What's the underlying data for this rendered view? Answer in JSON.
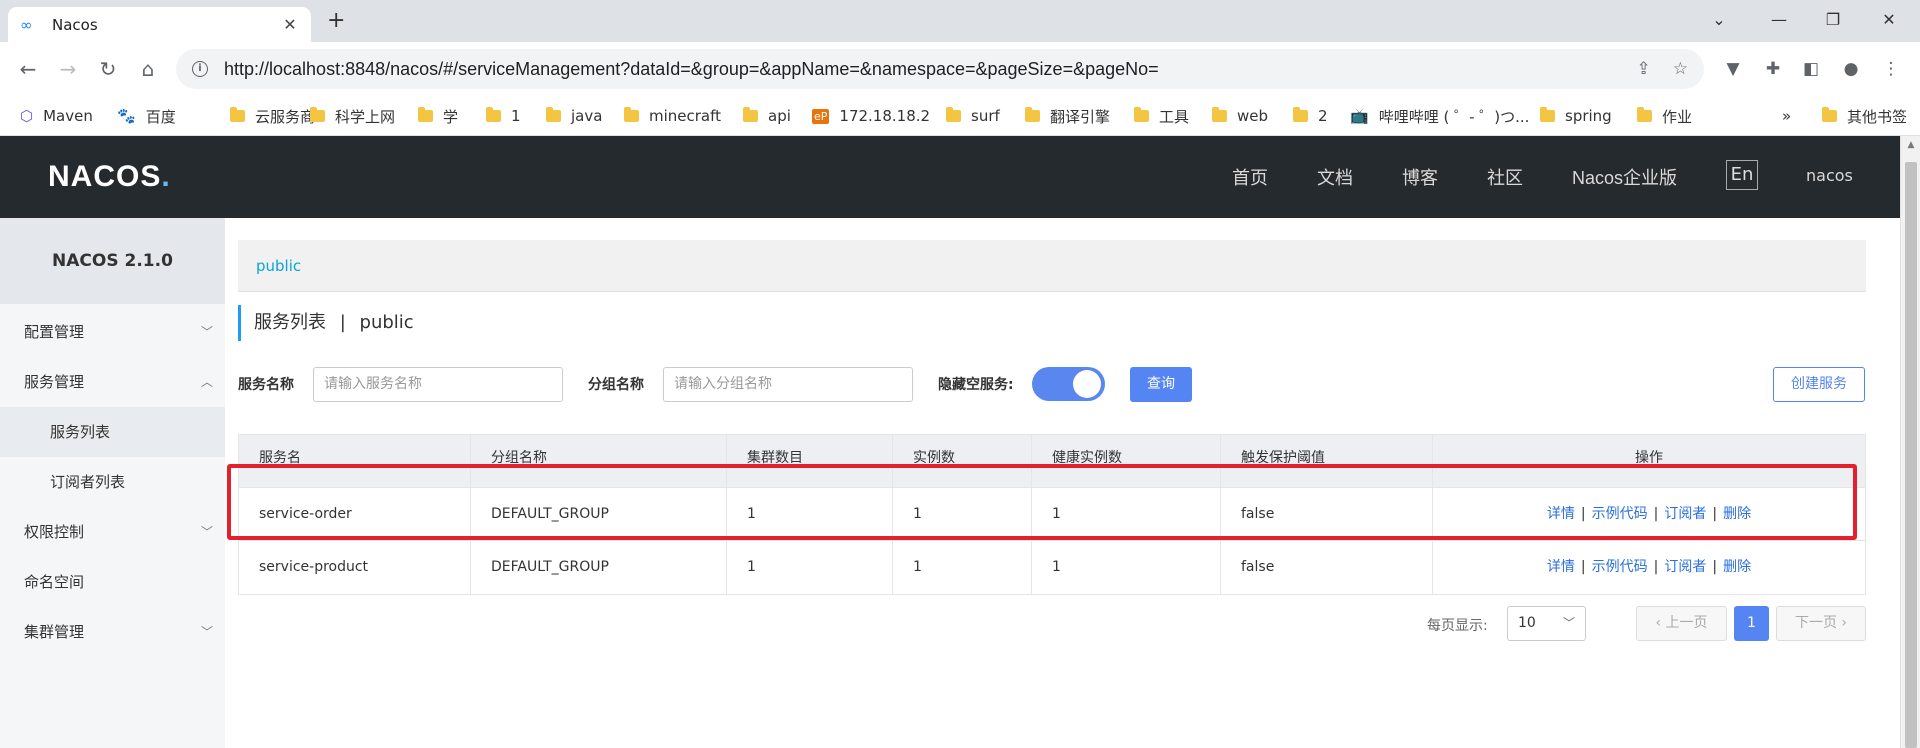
{
  "browser": {
    "tab_title": "Nacos",
    "url": "http://localhost:8848/nacos/#/serviceManagement?dataId=&group=&appName=&namespace=&pageSize=&pageNo=",
    "bookmarks": [
      "Maven",
      "百度",
      "云服务商",
      "科学上网",
      "学",
      "1",
      "java",
      "minecraft",
      "api",
      "172.18.18.2",
      "surf",
      "翻译引擎",
      "工具",
      "web",
      "2",
      "哔哩哔哩 ( ゜- ゜)つ...",
      "spring",
      "作业"
    ],
    "bookmarks_more": "»",
    "other_bookmarks": "其他书签"
  },
  "header": {
    "logo": "NACOS",
    "logo_dot": ".",
    "nav": [
      "首页",
      "文档",
      "博客",
      "社区",
      "Nacos企业版"
    ],
    "lang": "En",
    "user": "nacos"
  },
  "sidebar": {
    "title": "NACOS 2.1.0",
    "items": [
      {
        "label": "配置管理"
      },
      {
        "label": "服务管理"
      },
      {
        "label": "服务列表"
      },
      {
        "label": "订阅者列表"
      },
      {
        "label": "权限控制"
      },
      {
        "label": "命名空间"
      },
      {
        "label": "集群管理"
      }
    ]
  },
  "main": {
    "namespace_tab": "public",
    "page_title": "服务列表",
    "title_sep": "|",
    "title_ns": "public",
    "filters": {
      "service_name_label": "服务名称",
      "service_name_placeholder": "请输入服务名称",
      "group_name_label": "分组名称",
      "group_name_placeholder": "请输入分组名称",
      "hide_empty_label": "隐藏空服务:",
      "hide_empty_on": true,
      "query_button": "查询",
      "create_button": "创建服务"
    },
    "table": {
      "headers": [
        "服务名",
        "分组名称",
        "集群数目",
        "实例数",
        "健康实例数",
        "触发保护阈值",
        "操作"
      ],
      "rows": [
        {
          "name": "service-order",
          "group": "DEFAULT_GROUP",
          "clusters": "1",
          "instances": "1",
          "healthy": "1",
          "threshold": "false"
        },
        {
          "name": "service-product",
          "group": "DEFAULT_GROUP",
          "clusters": "1",
          "instances": "1",
          "healthy": "1",
          "threshold": "false"
        }
      ],
      "ops": [
        "详情",
        "示例代码",
        "订阅者",
        "删除"
      ],
      "ops_sep": "|"
    },
    "pagination": {
      "per_page_label": "每页显示:",
      "per_page_value": "10",
      "prev": "上一页",
      "next": "下一页",
      "current_page": "1"
    }
  },
  "colors": {
    "accent": "#5584f3",
    "header_bg": "#252a2f",
    "highlight": "#e4202c",
    "link": "#2a6fe0"
  }
}
